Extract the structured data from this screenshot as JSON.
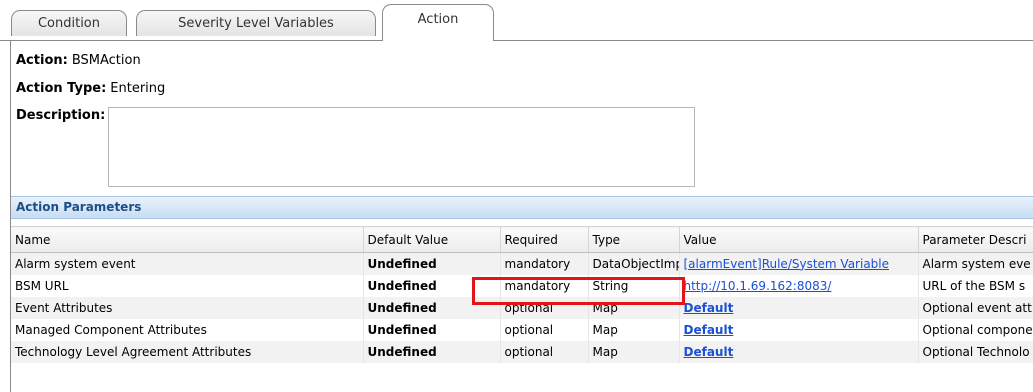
{
  "tabs": [
    {
      "label": "Condition"
    },
    {
      "label": "Severity Level Variables"
    },
    {
      "label": "Action"
    }
  ],
  "action": {
    "name_label": "Action:",
    "name_value": "BSMAction",
    "type_label": "Action Type:",
    "type_value": "Entering",
    "description_label": "Description:",
    "description_value": ""
  },
  "params": {
    "title": "Action Parameters",
    "columns": [
      "Name",
      "Default Value",
      "Required",
      "Type",
      "Value",
      "Parameter Descri"
    ],
    "rows": [
      [
        "Alarm system event",
        "Undefined",
        "mandatory",
        "DataObjectImpl",
        "[alarmEvent]Rule/System Variable",
        "Alarm system eve"
      ],
      [
        "BSM URL",
        "Undefined",
        "mandatory",
        "String",
        "http://10.1.69.162:8083/",
        "URL of the BSM s"
      ],
      [
        "Event Attributes",
        "Undefined",
        "optional",
        "Map",
        "Default",
        "Optional event att"
      ],
      [
        "Managed Component Attributes",
        "Undefined",
        "optional",
        "Map",
        "Default",
        "Optional compone"
      ],
      [
        "Technology Level Agreement Attributes",
        "Undefined",
        "optional",
        "Map",
        "Default",
        "Optional Technolo"
      ]
    ]
  },
  "colors": {
    "highlight": "#e4141b",
    "link": "#1a4fd6",
    "header_text": "#1c4e86"
  }
}
